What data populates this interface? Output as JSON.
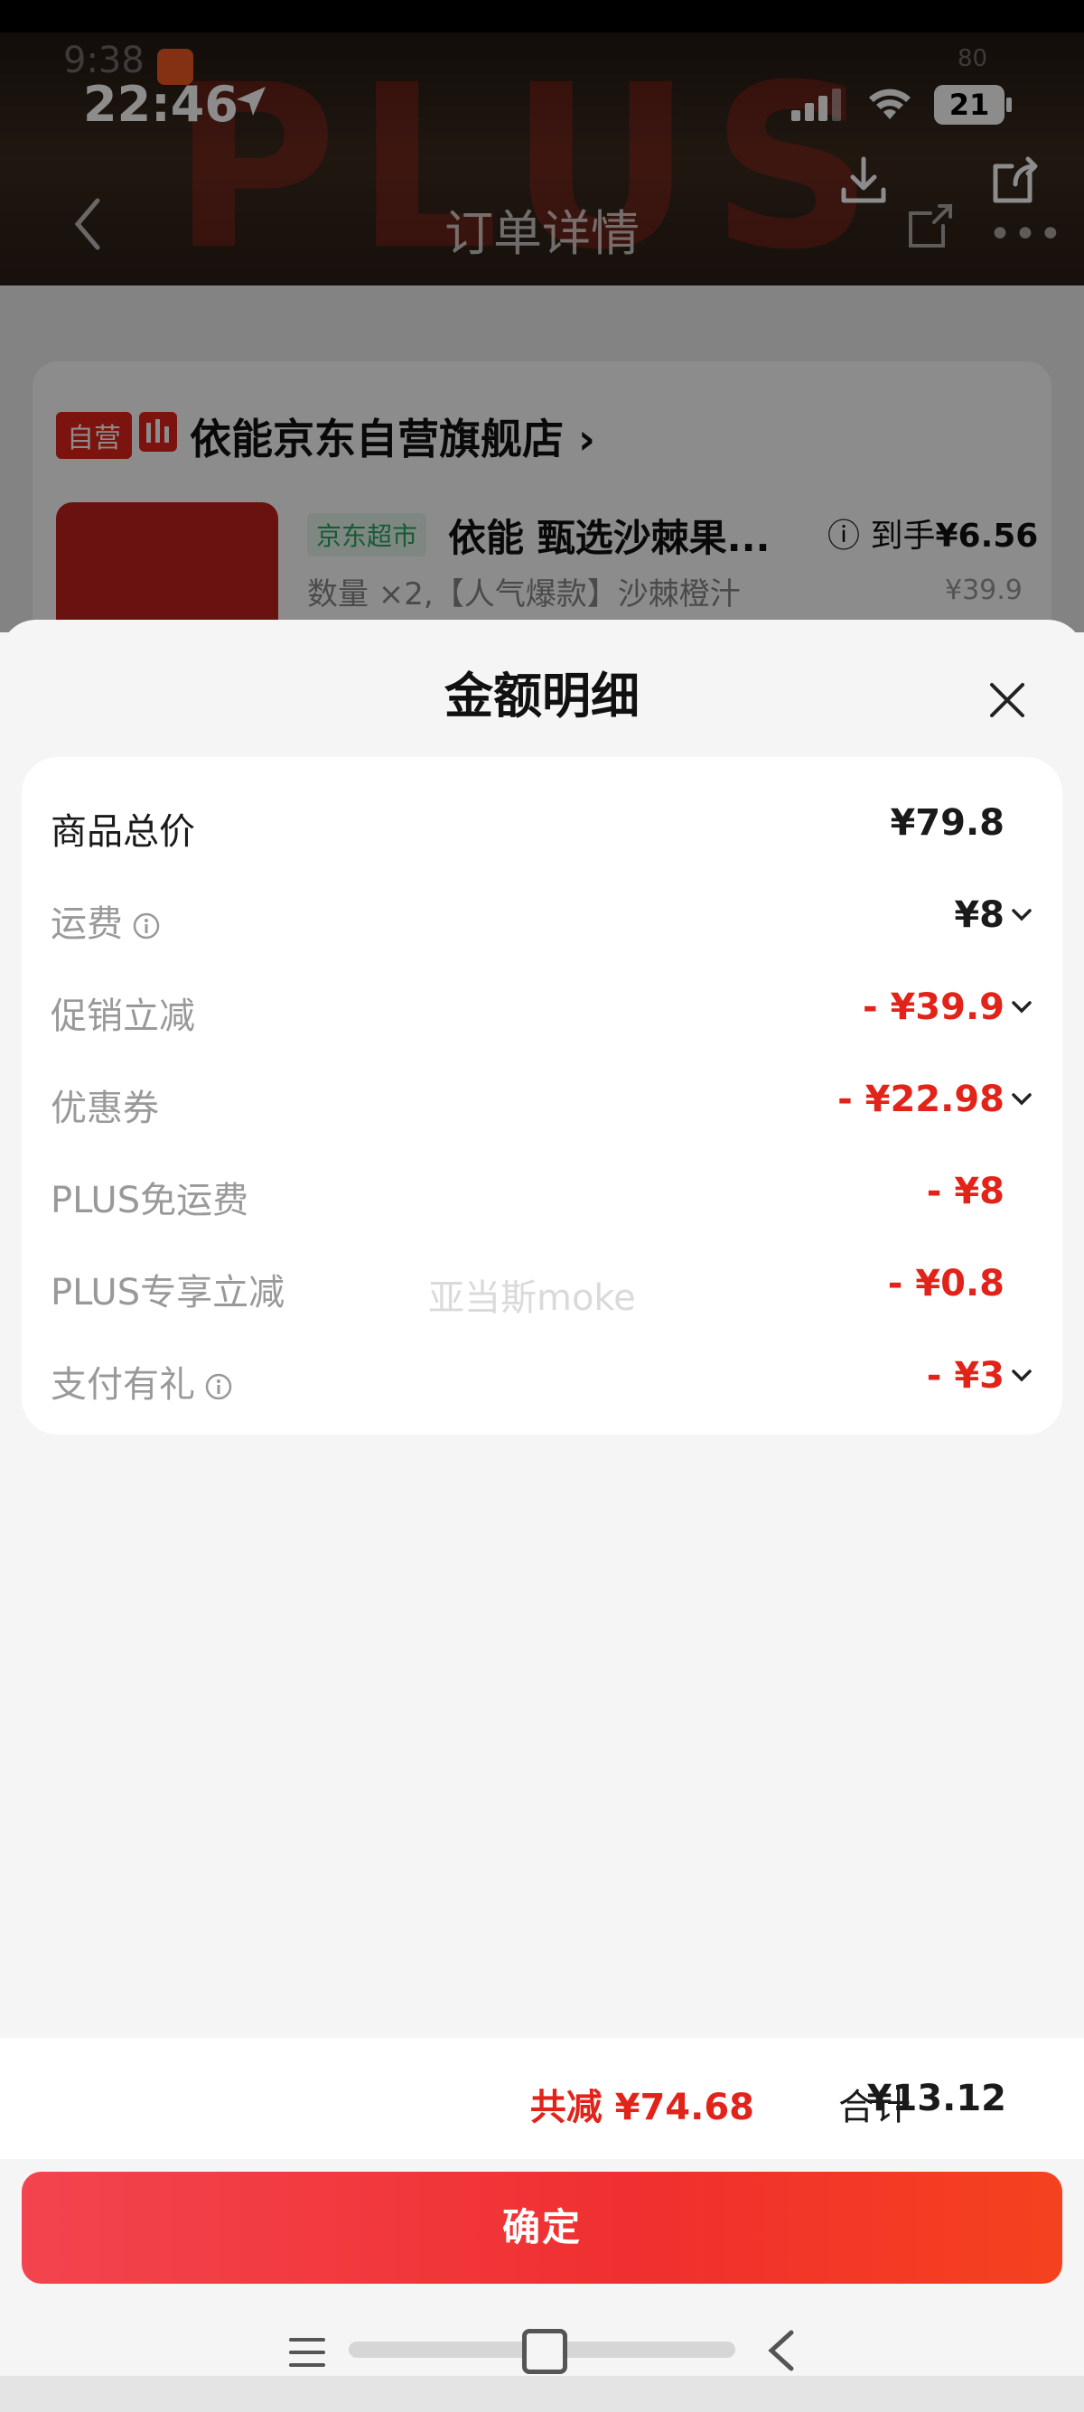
{
  "status_bar": {
    "time": "22:46",
    "battery": "21",
    "ghost_time": "9:38",
    "ghost_battery": "80"
  },
  "background_page": {
    "nav_title": "订单详情",
    "store": {
      "tag_self": "自营",
      "name": "依能京东自营旗舰店",
      "arrow": "›"
    },
    "product": {
      "tag": "京东超市",
      "name": "依能 甄选沙棘果...",
      "price_label": "到手",
      "price": "¥6.56",
      "quantity_line": "数量 ×2,【人气爆款】沙棘橙汁",
      "orig_price": "¥39.9"
    }
  },
  "sheet": {
    "title": "金额明细",
    "rows": [
      {
        "label": "商品总价",
        "value": "¥79.8"
      },
      {
        "label": "运费",
        "value": "¥8"
      },
      {
        "label": "促销立减",
        "value": "- ¥39.9"
      },
      {
        "label": "优惠券",
        "value": "- ¥22.98"
      },
      {
        "label": "PLUS免运费",
        "value": "- ¥8"
      },
      {
        "label": "PLUS专享立减",
        "value": "- ¥0.8"
      },
      {
        "label": "支付有礼",
        "value": "- ¥3"
      }
    ],
    "watermark": "亚当斯moke"
  },
  "footer": {
    "saved": "共减 ¥74.68",
    "total_label": "合计",
    "total_value": "¥13.12"
  },
  "confirm_button": "确定",
  "colors": {
    "accent_red": "#e2231a",
    "button_red": "#f02f2f"
  }
}
